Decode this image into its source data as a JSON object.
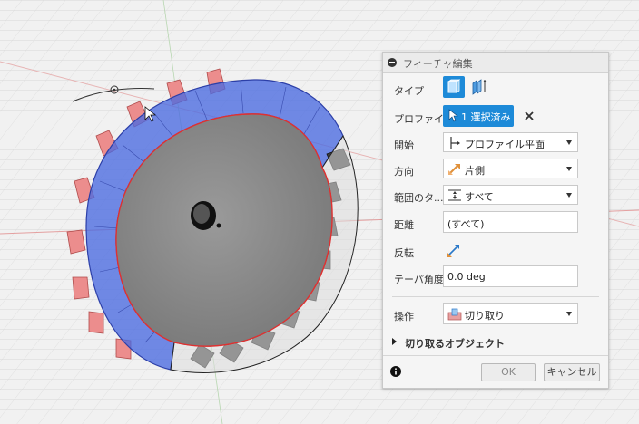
{
  "dialog": {
    "title": "フィーチャ編集",
    "fields": {
      "type_label": "タイプ",
      "profile_label": "プロファイル",
      "profile_value": "1 選択済み",
      "start_label": "開始",
      "start_value": "プロファイル平面",
      "direction_label": "方向",
      "direction_value": "片側",
      "extent_label": "範囲のタ...",
      "extent_value": "すべて",
      "distance_label": "距離",
      "distance_value": "(すべて)",
      "flip_label": "反転",
      "taper_label": "テーパ角度",
      "taper_value": "0.0 deg",
      "operation_label": "操作",
      "operation_value": "切り取り"
    },
    "objects_to_cut": "切り取るオブジェクト",
    "ok_label": "OK",
    "cancel_label": "キャンセル"
  },
  "colors": {
    "accent": "#1d8ad8",
    "selection_fill": "#3c5fd6",
    "tooth_red": "#e88080",
    "gear_gray": "#8a8a8a"
  }
}
